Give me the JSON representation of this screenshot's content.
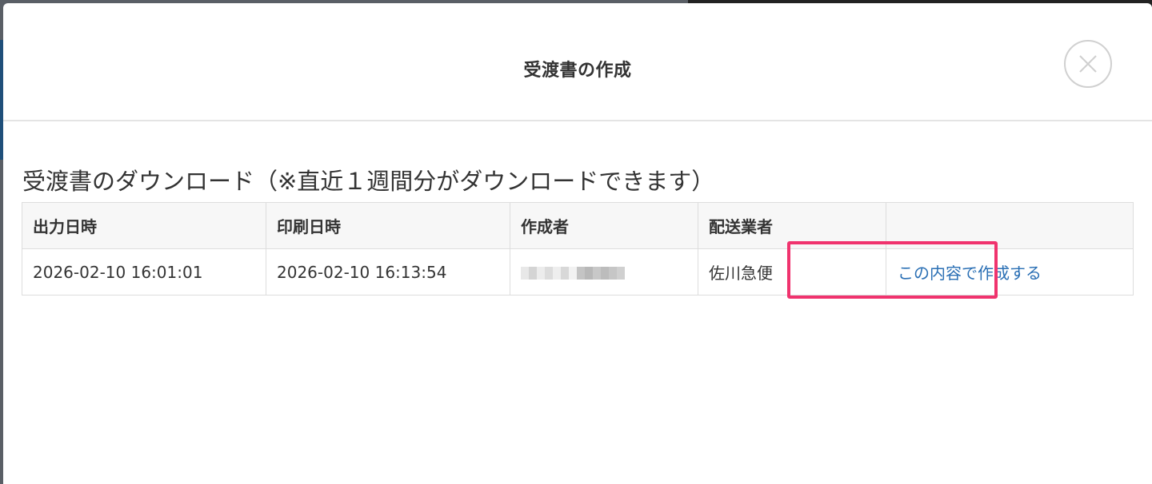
{
  "modal": {
    "title": "受渡書の作成"
  },
  "section": {
    "heading": "受渡書のダウンロード（※直近１週間分がダウンロードできます）"
  },
  "table": {
    "headers": [
      "出力日時",
      "印刷日時",
      "作成者",
      "配送業者",
      ""
    ],
    "rows": [
      {
        "output_datetime": "2026-02-10 16:01:01",
        "print_datetime": "2026-02-10 16:13:54",
        "creator": "",
        "carrier": "佐川急便",
        "action_label": "この内容で作成する"
      }
    ]
  },
  "colors": {
    "link": "#2a6fb4",
    "highlight": "#f0336e",
    "header_bg": "#f7f7f7",
    "border": "#dddddd"
  },
  "icons": {
    "close": "close-icon"
  }
}
